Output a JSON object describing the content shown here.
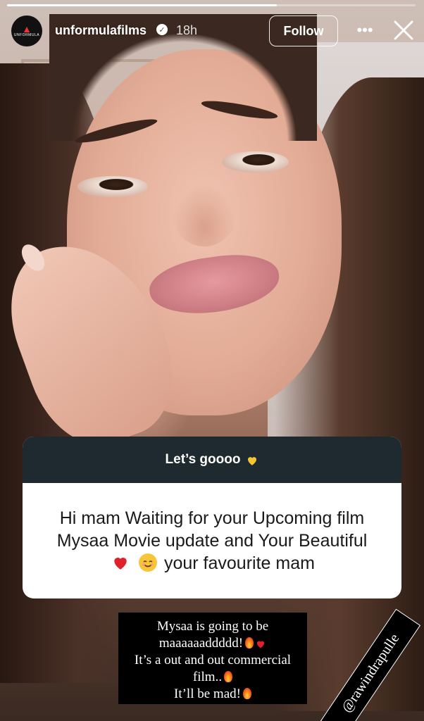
{
  "story": {
    "progress_fraction": 0.66,
    "account": {
      "username": "unformulafilms",
      "verified": true,
      "time": "18h",
      "avatar_text": "UNFORMULA"
    },
    "follow_label": "Follow",
    "more_icon": "more-icon",
    "close_icon": "close-icon"
  },
  "question_card": {
    "title": "Let’s goooo",
    "title_emoji": "yellow-heart-icon",
    "question_line1": "Hi mam Waiting for your Upcoming film",
    "question_line2": "Mysaa Movie update and Your Beautiful",
    "question_line3": "your favourite mam",
    "emojis": [
      "red-heart-icon",
      "smile-icon"
    ]
  },
  "reply": {
    "line1": "Mysaa is going to be",
    "line2": "maaaaaaddddd!",
    "line3": "It’s a out and out commercial",
    "line4": "film..",
    "line5": "It’ll be mad!"
  },
  "mention": "@rawindrapulle",
  "colors": {
    "card_header": "#1f2930",
    "card_body": "#ffffff",
    "reply_bg": "#000000",
    "text_white": "#ffffff"
  }
}
